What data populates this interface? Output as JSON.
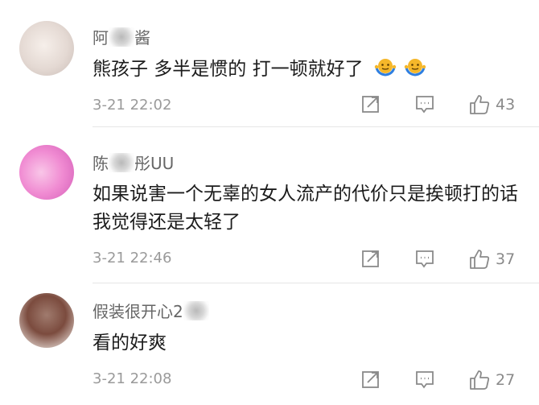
{
  "comments": [
    {
      "user_prefix": "阿",
      "user_suffix": "酱",
      "text": "熊孩子 多半是惯的 打一顿就好了",
      "time": "3-21 22:02",
      "likes": "43"
    },
    {
      "user_prefix": "陈",
      "user_suffix": "彤UU",
      "text": "如果说害一个无辜的女人流产的代价只是挨顿打的话我觉得还是太轻了",
      "time": "3-21 22:46",
      "likes": "37"
    },
    {
      "user_prefix": "假装很开心2",
      "user_suffix": "",
      "text": "看的好爽",
      "time": "3-21 22:08",
      "likes": "27"
    }
  ],
  "icons": {
    "share": "share-icon",
    "reply": "comment-icon",
    "like": "thumbs-up-icon",
    "emoji": "shrug-emoji-icon"
  },
  "colors": {
    "username": "#666666",
    "text": "#1c1c1c",
    "meta": "#9a9a9a",
    "icon": "#8a8a8a",
    "emoji": "#f5b72a"
  }
}
